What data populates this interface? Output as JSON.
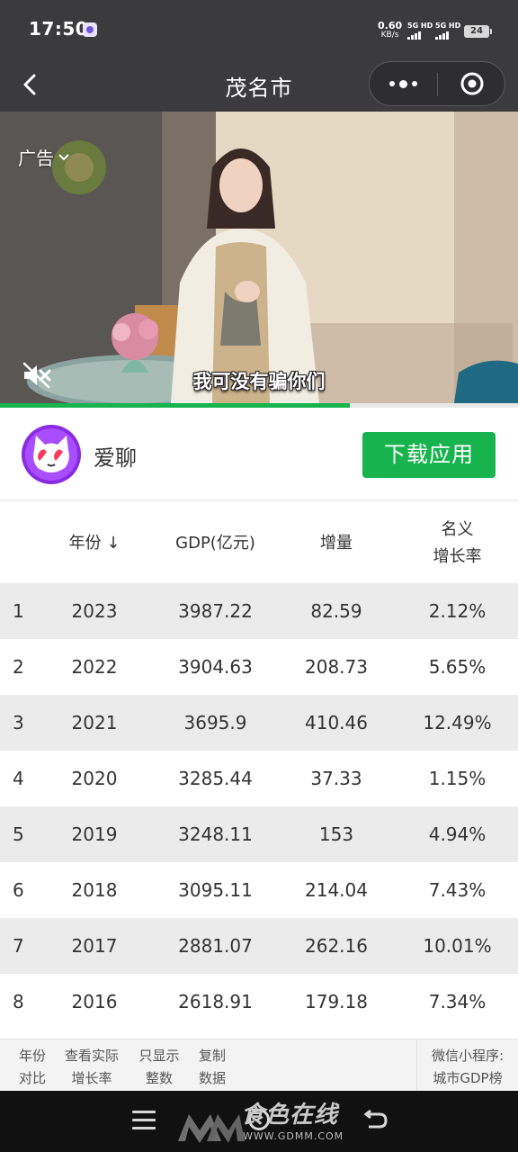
{
  "status_bar": {
    "time": "17:50",
    "net_speed": "0.60",
    "net_unit": "KB/s",
    "sim1_label": "5G HD",
    "sim2_label": "5G HD",
    "battery": "24"
  },
  "nav": {
    "title": "茂名市"
  },
  "ad": {
    "label": "广告",
    "subtitle": "我可没有骗你们",
    "progress": 0.675
  },
  "app_banner": {
    "name": "爱聊",
    "download_label": "下载应用"
  },
  "table": {
    "headers": {
      "year": "年份 ↓",
      "gdp": "GDP(亿元)",
      "increase": "增量",
      "growth_line1": "名义",
      "growth_line2": "增长率"
    },
    "rows": [
      {
        "rank": "1",
        "year": "2023",
        "gdp": "3987.22",
        "increase": "82.59",
        "growth": "2.12%"
      },
      {
        "rank": "2",
        "year": "2022",
        "gdp": "3904.63",
        "increase": "208.73",
        "growth": "5.65%"
      },
      {
        "rank": "3",
        "year": "2021",
        "gdp": "3695.9",
        "increase": "410.46",
        "growth": "12.49%"
      },
      {
        "rank": "4",
        "year": "2020",
        "gdp": "3285.44",
        "increase": "37.33",
        "growth": "1.15%"
      },
      {
        "rank": "5",
        "year": "2019",
        "gdp": "3248.11",
        "increase": "153",
        "growth": "4.94%"
      },
      {
        "rank": "6",
        "year": "2018",
        "gdp": "3095.11",
        "increase": "214.04",
        "growth": "7.43%"
      },
      {
        "rank": "7",
        "year": "2017",
        "gdp": "2881.07",
        "increase": "262.16",
        "growth": "10.01%"
      },
      {
        "rank": "8",
        "year": "2016",
        "gdp": "2618.91",
        "increase": "179.18",
        "growth": "7.34%"
      }
    ]
  },
  "toolbar": {
    "btn1_line1": "年份",
    "btn1_line2": "对比",
    "btn2_line1": "查看实际",
    "btn2_line2": "增长率",
    "btn3_line1": "只显示",
    "btn3_line2": "整数",
    "btn4_line1": "复制",
    "btn4_line2": "数据",
    "mini_line1": "微信小程序:",
    "mini_line2": "城市GDP榜"
  },
  "watermark": {
    "text": "食色在线",
    "url": "WWW.GDMM.COM"
  },
  "colors": {
    "accent_green": "#17b34e",
    "header_dark": "#3b3b3d",
    "row_shade": "#ebebeb"
  }
}
